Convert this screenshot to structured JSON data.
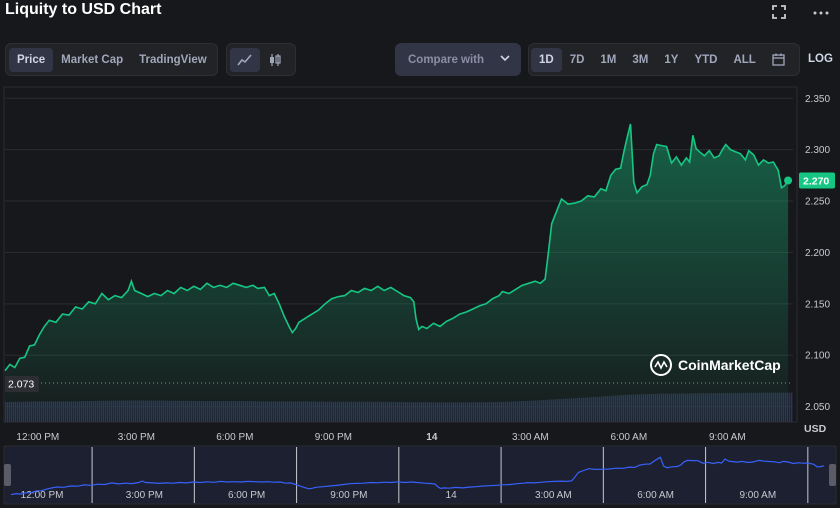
{
  "header": {
    "title": "Liquity to USD Chart",
    "fullscreen_icon": "fullscreen-icon",
    "more_icon": "more-icon"
  },
  "toolbar": {
    "view_tabs": [
      "Price",
      "Market Cap",
      "TradingView"
    ],
    "active_view": "Price",
    "chart_style_icons": [
      "line-chart-icon",
      "candlestick-icon"
    ],
    "compare_label": "Compare with",
    "ranges": [
      "1D",
      "7D",
      "1M",
      "3M",
      "1Y",
      "YTD",
      "ALL"
    ],
    "active_range": "1D",
    "calendar_icon": "calendar-icon",
    "log_label": "LOG"
  },
  "chart_data": {
    "type": "area",
    "y_ticks": [
      "2.350",
      "2.300",
      "2.250",
      "2.200",
      "2.150",
      "2.100",
      "2.050"
    ],
    "ylim": [
      2.035,
      2.36
    ],
    "y_unit_label": "USD",
    "x_tick_labels": [
      "12:00 PM",
      "3:00 PM",
      "6:00 PM",
      "9:00 PM",
      "14",
      "3:00 AM",
      "6:00 AM",
      "9:00 AM"
    ],
    "x_tick_hours": [
      1,
      4,
      7,
      10,
      13,
      16,
      19,
      22
    ],
    "xlim_hours": [
      0,
      24
    ],
    "open_price_label": "2.073",
    "open_price": 2.073,
    "current_price_label": "2.270",
    "current_price": 2.27,
    "watermark": "CoinMarketCap",
    "series": [
      {
        "values": [
          [
            0.0,
            2.085
          ],
          [
            0.15,
            2.091
          ],
          [
            0.3,
            2.088
          ],
          [
            0.45,
            2.097
          ],
          [
            0.6,
            2.098
          ],
          [
            0.75,
            2.109
          ],
          [
            0.9,
            2.11
          ],
          [
            1.05,
            2.12
          ],
          [
            1.2,
            2.128
          ],
          [
            1.35,
            2.134
          ],
          [
            1.55,
            2.132
          ],
          [
            1.75,
            2.14
          ],
          [
            1.95,
            2.139
          ],
          [
            2.15,
            2.147
          ],
          [
            2.35,
            2.145
          ],
          [
            2.55,
            2.152
          ],
          [
            2.75,
            2.15
          ],
          [
            2.95,
            2.16
          ],
          [
            3.15,
            2.154
          ],
          [
            3.35,
            2.158
          ],
          [
            3.55,
            2.156
          ],
          [
            3.75,
            2.163
          ],
          [
            3.85,
            2.172
          ],
          [
            3.95,
            2.163
          ],
          [
            4.15,
            2.16
          ],
          [
            4.35,
            2.157
          ],
          [
            4.55,
            2.16
          ],
          [
            4.75,
            2.158
          ],
          [
            4.95,
            2.163
          ],
          [
            5.15,
            2.16
          ],
          [
            5.35,
            2.166
          ],
          [
            5.55,
            2.163
          ],
          [
            5.75,
            2.167
          ],
          [
            5.95,
            2.164
          ],
          [
            6.15,
            2.17
          ],
          [
            6.35,
            2.166
          ],
          [
            6.55,
            2.168
          ],
          [
            6.75,
            2.166
          ],
          [
            6.95,
            2.17
          ],
          [
            7.15,
            2.168
          ],
          [
            7.35,
            2.166
          ],
          [
            7.55,
            2.168
          ],
          [
            7.7,
            2.165
          ],
          [
            7.9,
            2.166
          ],
          [
            8.05,
            2.158
          ],
          [
            8.2,
            2.16
          ],
          [
            8.35,
            2.15
          ],
          [
            8.5,
            2.138
          ],
          [
            8.65,
            2.128
          ],
          [
            8.75,
            2.122
          ],
          [
            8.85,
            2.126
          ],
          [
            8.95,
            2.132
          ],
          [
            9.15,
            2.136
          ],
          [
            9.35,
            2.14
          ],
          [
            9.55,
            2.144
          ],
          [
            9.75,
            2.15
          ],
          [
            9.95,
            2.155
          ],
          [
            10.15,
            2.157
          ],
          [
            10.35,
            2.158
          ],
          [
            10.55,
            2.163
          ],
          [
            10.75,
            2.161
          ],
          [
            10.95,
            2.165
          ],
          [
            11.15,
            2.163
          ],
          [
            11.35,
            2.167
          ],
          [
            11.55,
            2.163
          ],
          [
            11.75,
            2.166
          ],
          [
            11.95,
            2.162
          ],
          [
            12.15,
            2.158
          ],
          [
            12.35,
            2.156
          ],
          [
            12.45,
            2.152
          ],
          [
            12.52,
            2.135
          ],
          [
            12.6,
            2.125
          ],
          [
            12.7,
            2.128
          ],
          [
            12.85,
            2.126
          ],
          [
            13.05,
            2.131
          ],
          [
            13.25,
            2.128
          ],
          [
            13.45,
            2.133
          ],
          [
            13.65,
            2.136
          ],
          [
            13.85,
            2.14
          ],
          [
            14.05,
            2.142
          ],
          [
            14.25,
            2.145
          ],
          [
            14.45,
            2.148
          ],
          [
            14.65,
            2.15
          ],
          [
            14.85,
            2.155
          ],
          [
            15.05,
            2.158
          ],
          [
            15.15,
            2.162
          ],
          [
            15.35,
            2.16
          ],
          [
            15.55,
            2.164
          ],
          [
            15.75,
            2.168
          ],
          [
            15.95,
            2.17
          ],
          [
            16.15,
            2.172
          ],
          [
            16.3,
            2.17
          ],
          [
            16.45,
            2.174
          ],
          [
            16.55,
            2.2
          ],
          [
            16.65,
            2.228
          ],
          [
            16.8,
            2.24
          ],
          [
            16.95,
            2.252
          ],
          [
            17.15,
            2.247
          ],
          [
            17.35,
            2.248
          ],
          [
            17.55,
            2.25
          ],
          [
            17.75,
            2.255
          ],
          [
            17.95,
            2.254
          ],
          [
            18.15,
            2.262
          ],
          [
            18.3,
            2.26
          ],
          [
            18.45,
            2.275
          ],
          [
            18.6,
            2.281
          ],
          [
            18.75,
            2.282
          ],
          [
            18.85,
            2.298
          ],
          [
            18.95,
            2.312
          ],
          [
            19.05,
            2.325
          ],
          [
            19.15,
            2.268
          ],
          [
            19.25,
            2.258
          ],
          [
            19.4,
            2.264
          ],
          [
            19.55,
            2.266
          ],
          [
            19.65,
            2.275
          ],
          [
            19.75,
            2.296
          ],
          [
            19.85,
            2.305
          ],
          [
            20.0,
            2.304
          ],
          [
            20.15,
            2.303
          ],
          [
            20.3,
            2.287
          ],
          [
            20.45,
            2.293
          ],
          [
            20.6,
            2.285
          ],
          [
            20.75,
            2.292
          ],
          [
            20.85,
            2.288
          ],
          [
            20.95,
            2.314
          ],
          [
            21.05,
            2.301
          ],
          [
            21.15,
            2.298
          ],
          [
            21.3,
            2.294
          ],
          [
            21.45,
            2.299
          ],
          [
            21.6,
            2.292
          ],
          [
            21.75,
            2.294
          ],
          [
            21.85,
            2.3
          ],
          [
            21.95,
            2.305
          ],
          [
            22.1,
            2.3
          ],
          [
            22.25,
            2.298
          ],
          [
            22.4,
            2.296
          ],
          [
            22.55,
            2.29
          ],
          [
            22.65,
            2.299
          ],
          [
            22.8,
            2.295
          ],
          [
            22.95,
            2.285
          ],
          [
            23.1,
            2.29
          ],
          [
            23.25,
            2.287
          ],
          [
            23.4,
            2.288
          ],
          [
            23.55,
            2.28
          ],
          [
            23.65,
            2.263
          ],
          [
            23.75,
            2.265
          ],
          [
            23.85,
            2.27
          ]
        ]
      }
    ],
    "volume_series": [
      [
        0,
        0.62
      ],
      [
        1,
        0.64
      ],
      [
        2,
        0.64
      ],
      [
        3,
        0.66
      ],
      [
        4,
        0.67
      ],
      [
        5,
        0.66
      ],
      [
        6,
        0.65
      ],
      [
        7,
        0.65
      ],
      [
        8,
        0.64
      ],
      [
        9,
        0.64
      ],
      [
        10,
        0.63
      ],
      [
        11,
        0.63
      ],
      [
        12,
        0.62
      ],
      [
        13,
        0.61
      ],
      [
        14,
        0.61
      ],
      [
        15,
        0.62
      ],
      [
        16,
        0.66
      ],
      [
        17,
        0.72
      ],
      [
        18,
        0.78
      ],
      [
        19,
        0.85
      ],
      [
        20,
        0.88
      ],
      [
        21,
        0.89
      ],
      [
        22,
        0.9
      ],
      [
        23,
        0.91
      ],
      [
        24,
        0.91
      ]
    ],
    "navigator": {
      "x_tick_labels": [
        "12:00 PM",
        "3:00 PM",
        "6:00 PM",
        "9:00 PM",
        "14",
        "3:00 AM",
        "6:00 AM",
        "9:00 AM"
      ]
    }
  },
  "colors": {
    "background": "#17181b",
    "line": "#16c784",
    "area_top": "#16c784",
    "volume": "#2b3459",
    "navigator_line": "#3861fb",
    "price_badge": "#16c784"
  }
}
